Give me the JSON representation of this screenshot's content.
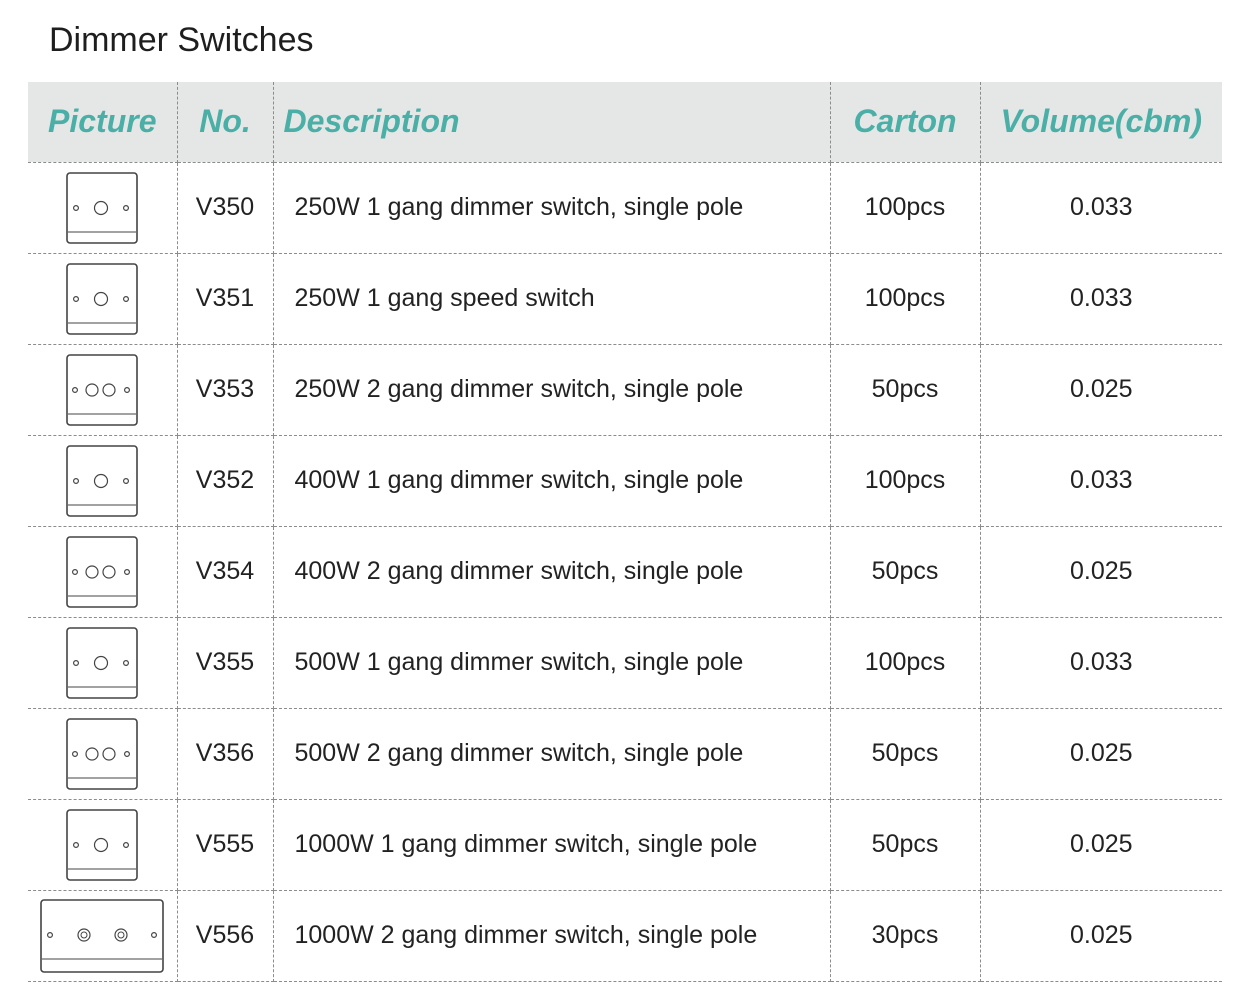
{
  "title": "Dimmer Switches",
  "colors": {
    "header_text": "#4aafa6",
    "header_bg": "#e5e7e7",
    "divider": "#8c8c8c"
  },
  "columns": {
    "picture": "Picture",
    "no": "No.",
    "description": "Description",
    "carton": "Carton",
    "volume": "Volume(cbm)"
  },
  "rows": [
    {
      "no": "V350",
      "description": "250W 1 gang dimmer switch, single pole",
      "carton": "100pcs",
      "volume": "0.033",
      "picture_icon": "single-knob-switch-icon"
    },
    {
      "no": "V351",
      "description": "250W 1 gang speed switch",
      "carton": "100pcs",
      "volume": "0.033",
      "picture_icon": "single-knob-switch-icon"
    },
    {
      "no": "V353",
      "description": "250W 2 gang dimmer switch, single pole",
      "carton": "50pcs",
      "volume": "0.025",
      "picture_icon": "double-knob-switch-icon"
    },
    {
      "no": "V352",
      "description": "400W 1 gang dimmer switch, single pole",
      "carton": "100pcs",
      "volume": "0.033",
      "picture_icon": "single-knob-switch-icon"
    },
    {
      "no": "V354",
      "description": "400W 2 gang dimmer switch, single pole",
      "carton": "50pcs",
      "volume": "0.025",
      "picture_icon": "double-knob-switch-icon"
    },
    {
      "no": "V355",
      "description": "500W 1 gang dimmer switch, single pole",
      "carton": "100pcs",
      "volume": "0.033",
      "picture_icon": "single-knob-switch-icon"
    },
    {
      "no": "V356",
      "description": "500W 2 gang dimmer switch, single pole",
      "carton": "50pcs",
      "volume": "0.025",
      "picture_icon": "double-knob-switch-icon"
    },
    {
      "no": "V555",
      "description": "1000W 1 gang dimmer switch, single pole",
      "carton": "50pcs",
      "volume": "0.025",
      "picture_icon": "single-knob-switch-icon"
    },
    {
      "no": "V556",
      "description": "1000W 2 gang dimmer switch, single pole",
      "carton": "30pcs",
      "volume": "0.025",
      "picture_icon": "wide-double-knob-switch-icon"
    }
  ]
}
